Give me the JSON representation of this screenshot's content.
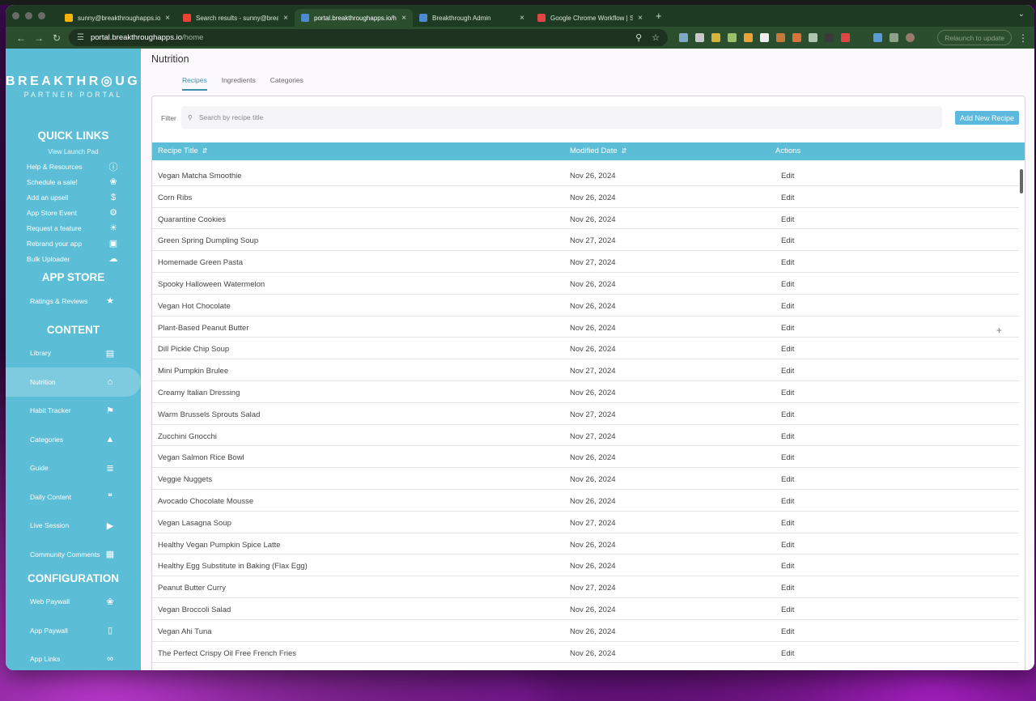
{
  "browser": {
    "tabs": [
      {
        "title": "sunny@breakthroughapps.io",
        "favicon_color": "#f4b400",
        "active": false
      },
      {
        "title": "Search results - sunny@breakthroughapps.io",
        "favicon_color": "#ea4335",
        "active": false
      },
      {
        "title": "portal.breakthroughapps.io/home",
        "favicon_color": "#4c8bd1",
        "active": true
      },
      {
        "title": "Breakthrough Admin",
        "favicon_color": "#4c8bd1",
        "active": false
      },
      {
        "title": "Google Chrome Workflow | S",
        "favicon_color": "#e04545",
        "active": false
      }
    ],
    "new_tab": "+",
    "url_host": "portal.breakthroughapps.io",
    "url_path": "/home",
    "relaunch_label": "Relaunch to update",
    "colors": {
      "tabstrip": "#1f3a22",
      "toolbar": "#2b4e2e"
    }
  },
  "sidebar": {
    "brand_name": "BREAKTHR◎UGH",
    "brand_sub": "PARTNER PORTAL",
    "quick_links_title": "QUICK LINKS",
    "view_launch_pad": "View Launch Pad",
    "quick_links": [
      {
        "label": "Help & Resources",
        "icon": "help-icon",
        "glyph": "ⓘ"
      },
      {
        "label": "Schedule a sale!",
        "icon": "tag-icon",
        "glyph": "❀"
      },
      {
        "label": "Add an upsell",
        "icon": "dollar-icon",
        "glyph": "$"
      },
      {
        "label": "App Store Event",
        "icon": "gear-icon",
        "glyph": "⚙"
      },
      {
        "label": "Request a feature",
        "icon": "lightbulb-icon",
        "glyph": "☀"
      },
      {
        "label": "Rebrand your app",
        "icon": "picture-icon",
        "glyph": "▣"
      },
      {
        "label": "Bulk Uploader",
        "icon": "cloud-upload-icon",
        "glyph": "☁"
      }
    ],
    "app_store_title": "APP STORE",
    "app_store_items": [
      {
        "label": "Ratings & Reviews",
        "icon": "star-icon",
        "glyph": "★"
      }
    ],
    "content_title": "CONTENT",
    "content_items": [
      {
        "label": "Library",
        "icon": "book-icon",
        "glyph": "▤",
        "active": false
      },
      {
        "label": "Nutrition",
        "icon": "house-icon",
        "glyph": "⌂",
        "active": true
      },
      {
        "label": "Habit Tracker",
        "icon": "walking-icon",
        "glyph": "⚑",
        "active": false
      },
      {
        "label": "Categories",
        "icon": "shapes-icon",
        "glyph": "▲",
        "active": false
      },
      {
        "label": "Guide",
        "icon": "document-icon",
        "glyph": "≣",
        "active": false
      },
      {
        "label": "Daily Content",
        "icon": "quote-icon",
        "glyph": "❝",
        "active": false
      },
      {
        "label": "Live Session",
        "icon": "video-icon",
        "glyph": "▶",
        "active": false
      },
      {
        "label": "Community Comments",
        "icon": "comment-icon",
        "glyph": "▦",
        "active": false
      }
    ],
    "configuration_title": "CONFIGURATION",
    "configuration_items": [
      {
        "label": "Web Paywall",
        "icon": "tag-icon",
        "glyph": "❀"
      },
      {
        "label": "App Paywall",
        "icon": "phone-icon",
        "glyph": "▯"
      },
      {
        "label": "App Links",
        "icon": "link-icon",
        "glyph": "∞"
      }
    ],
    "color": "#5bbdd6"
  },
  "main": {
    "page_title": "Nutrition",
    "tabs": [
      {
        "label": "Recipes",
        "active": true
      },
      {
        "label": "Ingredients",
        "active": false
      },
      {
        "label": "Categories",
        "active": false
      }
    ],
    "filter_label": "Filter",
    "search_placeholder": "Search by recipe title",
    "add_button": "Add New Recipe",
    "columns": [
      "Recipe Title",
      "Modified Date",
      "Actions"
    ],
    "rows": [
      {
        "title": "Vegan Matcha Smoothie",
        "date": "Nov 26, 2024",
        "action": "Edit"
      },
      {
        "title": "Corn Ribs",
        "date": "Nov 26, 2024",
        "action": "Edit"
      },
      {
        "title": "Quarantine Cookies",
        "date": "Nov 26, 2024",
        "action": "Edit"
      },
      {
        "title": "Green Spring Dumpling Soup",
        "date": "Nov 27, 2024",
        "action": "Edit"
      },
      {
        "title": "Homemade Green Pasta",
        "date": "Nov 27, 2024",
        "action": "Edit"
      },
      {
        "title": "Spooky Halloween Watermelon",
        "date": "Nov 26, 2024",
        "action": "Edit"
      },
      {
        "title": "Vegan Hot Chocolate",
        "date": "Nov 26, 2024",
        "action": "Edit"
      },
      {
        "title": "Plant-Based Peanut Butter",
        "date": "Nov 26, 2024",
        "action": "Edit"
      },
      {
        "title": "Dill Pickle Chip Soup",
        "date": "Nov 26, 2024",
        "action": "Edit"
      },
      {
        "title": "Mini Pumpkin Brulee",
        "date": "Nov 27, 2024",
        "action": "Edit"
      },
      {
        "title": "Creamy Italian Dressing",
        "date": "Nov 26, 2024",
        "action": "Edit"
      },
      {
        "title": "Warm Brussels Sprouts Salad",
        "date": "Nov 27, 2024",
        "action": "Edit"
      },
      {
        "title": "Zucchini Gnocchi",
        "date": "Nov 27, 2024",
        "action": "Edit"
      },
      {
        "title": "Vegan Salmon Rice Bowl",
        "date": "Nov 26, 2024",
        "action": "Edit"
      },
      {
        "title": "Veggie Nuggets",
        "date": "Nov 26, 2024",
        "action": "Edit"
      },
      {
        "title": "Avocado Chocolate Mousse",
        "date": "Nov 26, 2024",
        "action": "Edit"
      },
      {
        "title": "Vegan Lasagna Soup",
        "date": "Nov 27, 2024",
        "action": "Edit"
      },
      {
        "title": "Healthy Vegan Pumpkin Spice Latte",
        "date": "Nov 26, 2024",
        "action": "Edit"
      },
      {
        "title": "Healthy Egg Substitute in Baking (Flax Egg)",
        "date": "Nov 26, 2024",
        "action": "Edit"
      },
      {
        "title": "Peanut Butter Curry",
        "date": "Nov 27, 2024",
        "action": "Edit"
      },
      {
        "title": "Vegan Broccoli Salad",
        "date": "Nov 26, 2024",
        "action": "Edit"
      },
      {
        "title": "Vegan Ahi Tuna",
        "date": "Nov 26, 2024",
        "action": "Edit"
      },
      {
        "title": "The Perfect Crispy Oil Free French Fries",
        "date": "Nov 26, 2024",
        "action": "Edit"
      }
    ],
    "accent": "#5bbdd6",
    "button_color": "#5cb8dd"
  }
}
